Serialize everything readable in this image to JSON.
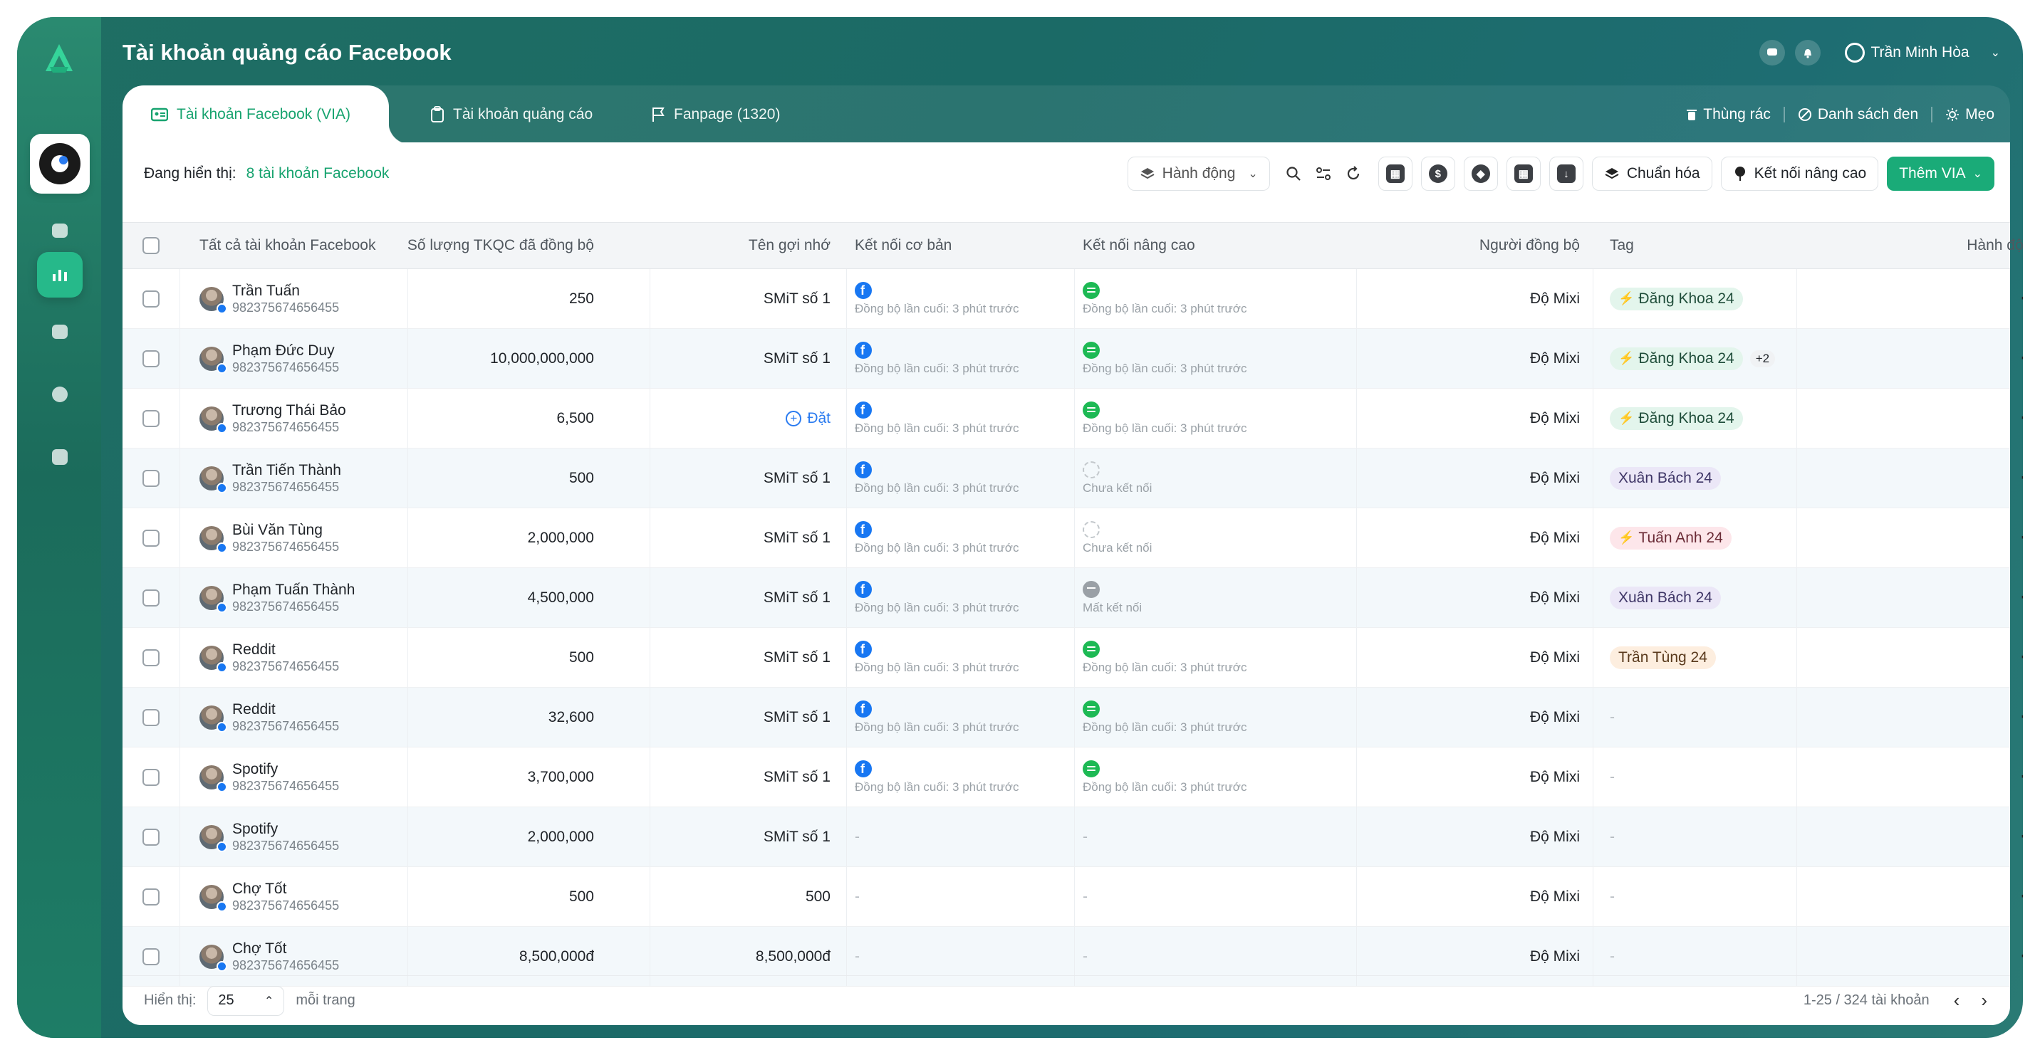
{
  "app": {
    "title": "Tài khoản quảng cáo Facebook"
  },
  "user": {
    "name": "Trần Minh Hòa"
  },
  "tabs": [
    {
      "label": "Tài khoản Facebook (VIA)",
      "icon": "id-card-icon"
    },
    {
      "label": "Tài khoản quảng cáo",
      "icon": "clipboard-icon"
    },
    {
      "label": "Fanpage (1320)",
      "icon": "flag-icon"
    }
  ],
  "tab_actions": [
    {
      "label": "Thùng rác",
      "icon": "trash-icon"
    },
    {
      "label": "Danh sách đen",
      "icon": "block-icon"
    },
    {
      "label": "Mẹo",
      "icon": "bulb-icon"
    }
  ],
  "toolbar": {
    "showing_label": "Đang hiển thị:",
    "showing_count": "8 tài khoản Facebook",
    "action_label": "Hành động",
    "normalize_label": "Chuẩn hóa",
    "advanced_connect_label": "Kết nối nâng cao",
    "add_label": "Thêm VIA"
  },
  "columns": [
    "Tất cả tài khoản Facebook",
    "Số lượng TKQC đã đồng bộ",
    "Tên gợi nhớ",
    "Kết nối cơ bản",
    "Kết nối nâng cao",
    "Người đồng bộ",
    "Tag",
    "Hành động"
  ],
  "rows": [
    {
      "name": "Trần Tuấn",
      "uid": "982375674656455",
      "count": "250",
      "alias": "SMiT số 1",
      "basic": "Đồng bộ lần cuối: 3 phút trước",
      "adv_status": "ok",
      "adv": "Đồng bộ lần cuối: 3 phút trước",
      "syncer": "Độ Mixi",
      "tag": "Đăng Khoa 24",
      "tag_color": "green",
      "tag_bolt": true,
      "tag_more": ""
    },
    {
      "name": "Phạm Đức Duy",
      "uid": "982375674656455",
      "count": "10,000,000,000",
      "alias": "SMiT số 1",
      "basic": "Đồng bộ lần cuối: 3 phút trước",
      "adv_status": "ok",
      "adv": "Đồng bộ lần cuối: 3 phút trước",
      "syncer": "Độ Mixi",
      "tag": "Đăng Khoa 24",
      "tag_color": "green",
      "tag_bolt": true,
      "tag_more": "+2"
    },
    {
      "name": "Trương Thái Bảo",
      "uid": "982375674656455",
      "count": "6,500",
      "alias": "Đặt",
      "alias_is_action": true,
      "basic": "Đồng bộ lần cuối: 3 phút trước",
      "adv_status": "ok",
      "adv": "Đồng bộ lần cuối: 3 phút trước",
      "syncer": "Độ Mixi",
      "tag": "Đăng Khoa 24",
      "tag_color": "green",
      "tag_bolt": true,
      "tag_more": ""
    },
    {
      "name": "Trần Tiến Thành",
      "uid": "982375674656455",
      "count": "500",
      "alias": "SMiT số 1",
      "basic": "Đồng bộ lần cuối: 3 phút trước",
      "adv_status": "pending",
      "adv": "Chưa kết nối",
      "syncer": "Độ Mixi",
      "tag": "Xuân Bách 24",
      "tag_color": "purple",
      "tag_bolt": false,
      "tag_more": ""
    },
    {
      "name": "Bùi Văn Tùng",
      "uid": "982375674656455",
      "count": "2,000,000",
      "alias": "SMiT số 1",
      "basic": "Đồng bộ lần cuối: 3 phút trước",
      "adv_status": "pending",
      "adv": "Chưa kết nối",
      "syncer": "Độ Mixi",
      "tag": "Tuấn Anh 24",
      "tag_color": "pink",
      "tag_bolt": true,
      "tag_more": ""
    },
    {
      "name": "Phạm Tuấn Thành",
      "uid": "982375674656455",
      "count": "4,500,000",
      "alias": "SMiT số 1",
      "basic": "Đồng bộ lần cuối: 3 phút trước",
      "adv_status": "lost",
      "adv": "Mất kết nối",
      "syncer": "Độ Mixi",
      "tag": "Xuân Bách 24",
      "tag_color": "purple",
      "tag_bolt": false,
      "tag_more": ""
    },
    {
      "name": "Reddit",
      "uid": "982375674656455",
      "count": "500",
      "alias": "SMiT số 1",
      "basic": "Đồng bộ lần cuối: 3 phút trước",
      "adv_status": "ok",
      "adv": "Đồng bộ lần cuối: 3 phút trước",
      "syncer": "Độ Mixi",
      "tag": "Trần Tùng 24",
      "tag_color": "peach",
      "tag_bolt": false,
      "tag_more": ""
    },
    {
      "name": "Reddit",
      "uid": "982375674656455",
      "count": "32,600",
      "alias": "SMiT số 1",
      "basic": "Đồng bộ lần cuối: 3 phút trước",
      "adv_status": "ok",
      "adv": "Đồng bộ lần cuối: 3 phút trước",
      "syncer": "Độ Mixi",
      "tag": "-",
      "tag_color": "",
      "tag_bolt": false,
      "tag_more": ""
    },
    {
      "name": "Spotify",
      "uid": "982375674656455",
      "count": "3,700,000",
      "alias": "SMiT số 1",
      "basic": "Đồng bộ lần cuối: 3 phút trước",
      "adv_status": "ok",
      "adv": "Đồng bộ lần cuối: 3 phút trước",
      "syncer": "Độ Mixi",
      "tag": "-",
      "tag_color": "",
      "tag_bolt": false,
      "tag_more": ""
    },
    {
      "name": "Spotify",
      "uid": "982375674656455",
      "count": "2,000,000",
      "alias": "SMiT số 1",
      "basic": "-",
      "adv_status": "none",
      "adv": "-",
      "syncer": "Độ Mixi",
      "tag": "-",
      "tag_color": "",
      "tag_bolt": false,
      "tag_more": ""
    },
    {
      "name": "Chợ Tốt",
      "uid": "982375674656455",
      "count": "500",
      "alias": "500",
      "basic": "-",
      "adv_status": "none",
      "adv": "-",
      "syncer": "Độ Mixi",
      "tag": "-",
      "tag_color": "",
      "tag_bolt": false,
      "tag_more": ""
    },
    {
      "name": "Chợ Tốt",
      "uid": "982375674656455",
      "count": "8,500,000đ",
      "alias": "8,500,000đ",
      "basic": "-",
      "adv_status": "none",
      "adv": "-",
      "syncer": "Độ Mixi",
      "tag": "-",
      "tag_color": "",
      "tag_bolt": false,
      "tag_more": ""
    }
  ],
  "footer": {
    "show_label": "Hiển thị:",
    "per_page": "25",
    "per_page_suffix": "mỗi trang",
    "range": "1-25 / 324 tài khoản"
  }
}
